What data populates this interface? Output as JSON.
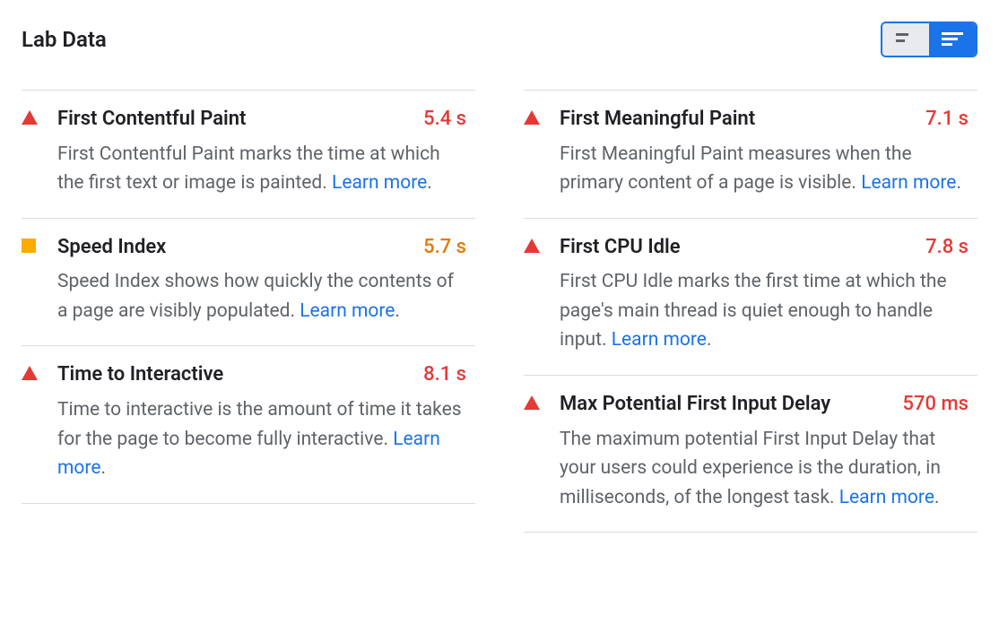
{
  "section_title": "Lab Data",
  "learn_more_label": "Learn more",
  "metrics": {
    "left": [
      {
        "title": "First Contentful Paint",
        "value": "5.4 s",
        "status": "red",
        "desc": "First Contentful Paint marks the time at which the first text or image is painted. "
      },
      {
        "title": "Speed Index",
        "value": "5.7 s",
        "status": "orange",
        "desc": "Speed Index shows how quickly the contents of a page are visibly populated. "
      },
      {
        "title": "Time to Interactive",
        "value": "8.1 s",
        "status": "red",
        "desc": "Time to interactive is the amount of time it takes for the page to become fully interactive. "
      }
    ],
    "right": [
      {
        "title": "First Meaningful Paint",
        "value": "7.1 s",
        "status": "red",
        "desc": "First Meaningful Paint measures when the primary content of a page is visible. "
      },
      {
        "title": "First CPU Idle",
        "value": "7.8 s",
        "status": "red",
        "desc": "First CPU Idle marks the first time at which the page's main thread is quiet enough to handle input. "
      },
      {
        "title": "Max Potential First Input Delay",
        "value": "570 ms",
        "status": "red",
        "desc": "The maximum potential First Input Delay that your users could experience is the duration, in milliseconds, of the longest task. "
      }
    ]
  }
}
